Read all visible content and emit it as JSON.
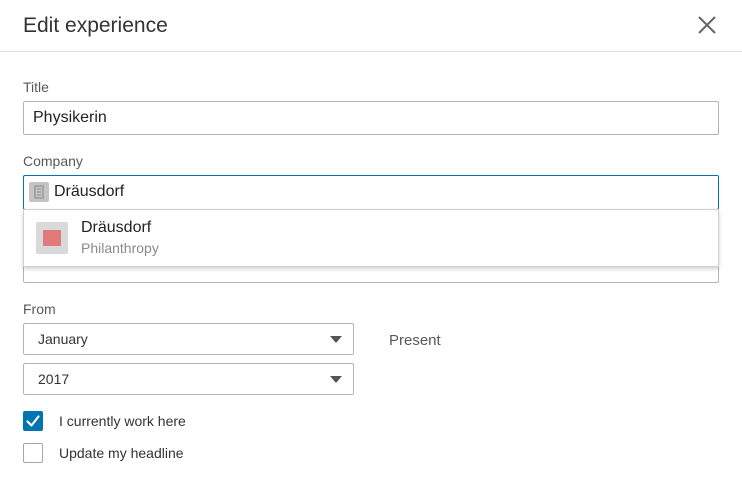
{
  "dialog": {
    "title": "Edit experience"
  },
  "title_field": {
    "label": "Title",
    "value": "Physikerin"
  },
  "company_field": {
    "label": "Company",
    "value": "Dräusdorf",
    "suggestions": [
      {
        "name": "Dräusdorf",
        "industry": "Philanthropy"
      }
    ]
  },
  "from_field": {
    "label": "From",
    "month": "January",
    "year": "2017"
  },
  "to_field": {
    "value": "Present"
  },
  "checkboxes": [
    {
      "label": "I currently work here",
      "checked": true
    },
    {
      "label": "Update my headline",
      "checked": false
    }
  ],
  "colors": {
    "accent": "#0073b1",
    "logo_color": "#e07b7b"
  },
  "icons": [
    "close-icon",
    "company-building-icon",
    "company-logo-icon",
    "chevron-down-icon",
    "checkmark-icon"
  ]
}
